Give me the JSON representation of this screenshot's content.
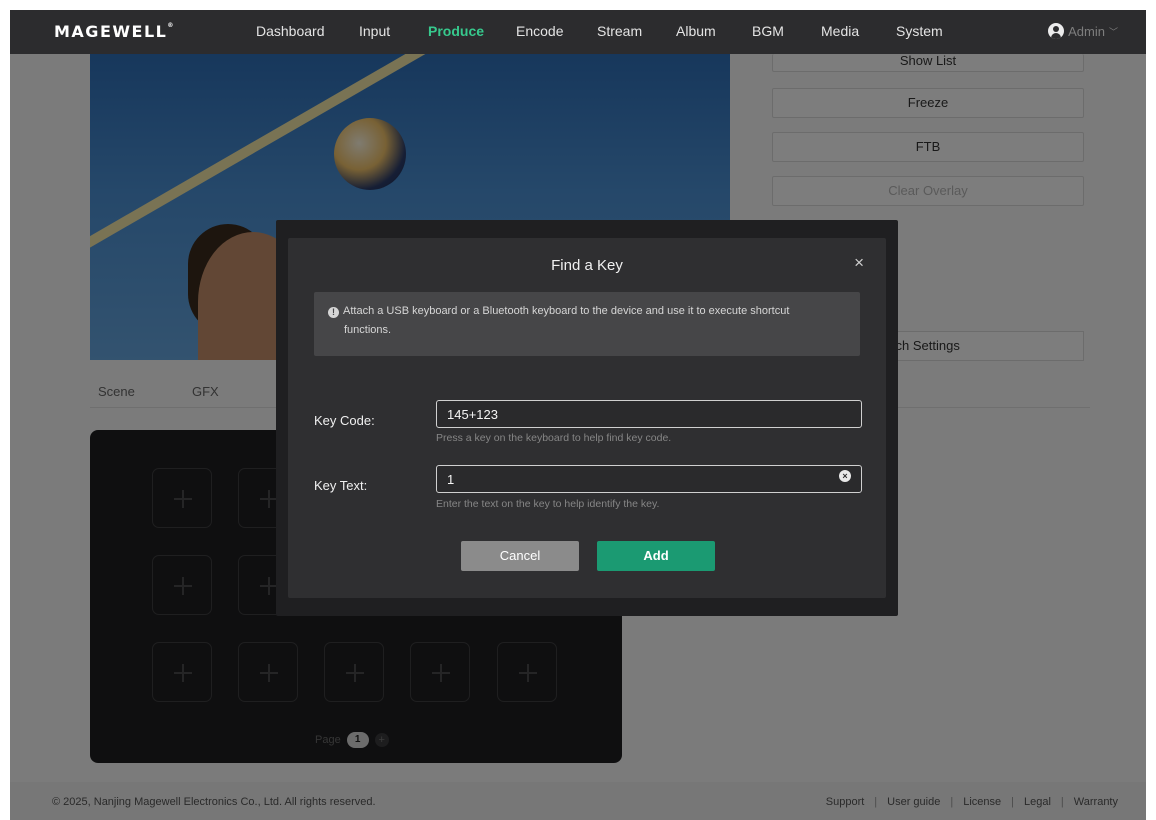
{
  "app": {
    "logo": "MAGEWELL"
  },
  "nav": {
    "items": [
      {
        "label": "Dashboard"
      },
      {
        "label": "Input"
      },
      {
        "label": "Produce"
      },
      {
        "label": "Encode"
      },
      {
        "label": "Stream"
      },
      {
        "label": "Album"
      },
      {
        "label": "BGM"
      },
      {
        "label": "Media"
      },
      {
        "label": "System"
      }
    ],
    "active": "Produce",
    "user": "Admin"
  },
  "controls": {
    "show_list": "Show List",
    "freeze": "Freeze",
    "ftb": "FTB",
    "clear_overlay": "Clear Overlay",
    "switch_settings": "itch Settings"
  },
  "tabs": [
    {
      "label": "Scene"
    },
    {
      "label": "GFX"
    }
  ],
  "pad": {
    "page_label": "Page",
    "page_number": "1",
    "add_page": "+"
  },
  "footer": {
    "copyright": "© 2025, Nanjing Magewell Electronics Co., Ltd. All rights reserved.",
    "links": [
      "Support",
      "User guide",
      "License",
      "Legal",
      "Warranty"
    ]
  },
  "modal": {
    "title": "Find a Key",
    "close": "×",
    "info_line1": "Attach a USB keyboard or a Bluetooth keyboard to the device and use it to execute shortcut",
    "info_line2": "functions.",
    "key_code_label": "Key Code:",
    "key_code_value": "145+123",
    "key_code_hint": "Press a key on the keyboard to help find key code.",
    "key_text_label": "Key Text:",
    "key_text_value": "1",
    "key_text_hint": "Enter the text on the key to help identify the key.",
    "cancel": "Cancel",
    "add": "Add"
  },
  "colors": {
    "accent": "#37c98d",
    "add_button": "#1b9a72",
    "topbar": "#2c2c2e"
  }
}
